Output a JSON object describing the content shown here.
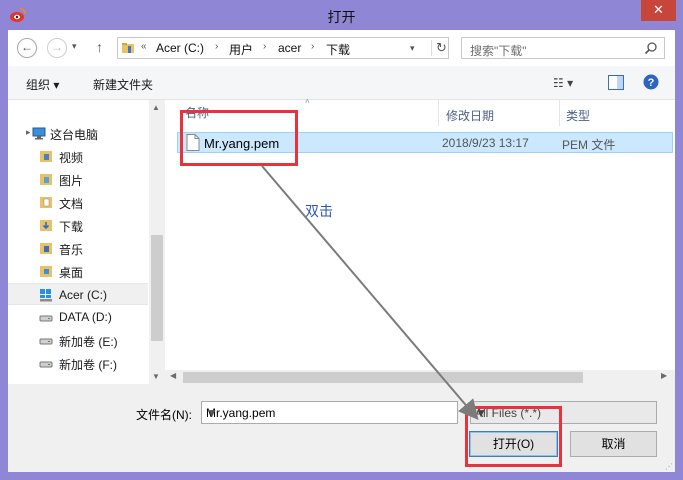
{
  "window": {
    "title": "打开",
    "close_glyph": "✕",
    "app_icon": "weibo-icon"
  },
  "address_bar": {
    "back_glyph": "←",
    "forward_glyph": "→",
    "recent_glyph": "▾",
    "up_glyph": "↑",
    "overflow": "«",
    "crumbs": [
      "Acer (C:)",
      "用户",
      "acer",
      "下载"
    ],
    "sep": "›",
    "dropdown_glyph": "▾",
    "refresh_glyph": "↻"
  },
  "search": {
    "placeholder": "搜索\"下载\""
  },
  "toolbar": {
    "organize": "组织 ▾",
    "new_folder": "新建文件夹",
    "view_glyph": "☷ ▾"
  },
  "nav": {
    "items": [
      {
        "label": "这台电脑",
        "icon": "computer-icon"
      },
      {
        "label": "视频",
        "icon": "video-folder-icon"
      },
      {
        "label": "图片",
        "icon": "pictures-folder-icon"
      },
      {
        "label": "文档",
        "icon": "documents-folder-icon"
      },
      {
        "label": "下载",
        "icon": "downloads-folder-icon"
      },
      {
        "label": "音乐",
        "icon": "music-folder-icon"
      },
      {
        "label": "桌面",
        "icon": "desktop-folder-icon"
      },
      {
        "label": "Acer (C:)",
        "icon": "windows-drive-icon"
      },
      {
        "label": "DATA (D:)",
        "icon": "drive-icon"
      },
      {
        "label": "新加卷 (E:)",
        "icon": "drive-icon"
      },
      {
        "label": "新加卷 (F:)",
        "icon": "drive-icon"
      }
    ]
  },
  "columns": {
    "name": "名称",
    "modified": "修改日期",
    "type": "类型"
  },
  "files": [
    {
      "name": "Mr.yang.pem",
      "modified": "2018/9/23 13:17",
      "type": "PEM 文件"
    }
  ],
  "annotation": {
    "text": "双击",
    "color": "#e8333d"
  },
  "bottom": {
    "filename_label": "文件名(N):",
    "filename_value": "Mr.yang.pem",
    "filter_value": "All Files (*.*)",
    "open_button": "打开(O)",
    "cancel_button": "取消"
  },
  "colors": {
    "title_bar": "#8f86d6",
    "selection": "#cce8ff",
    "header_text": "#4d6185"
  }
}
